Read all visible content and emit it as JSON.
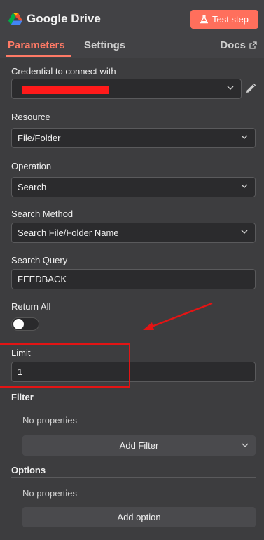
{
  "header": {
    "title": "Google Drive",
    "test_button": "Test step",
    "colors": {
      "accent": "#ff6f5c",
      "background": "#3d3d3f"
    }
  },
  "tabs": [
    {
      "label": "Parameters",
      "active": true
    },
    {
      "label": "Settings",
      "active": false
    }
  ],
  "docs_label": "Docs",
  "fields": {
    "credential": {
      "label": "Credential to connect with",
      "value": ""
    },
    "resource": {
      "label": "Resource",
      "value": "File/Folder"
    },
    "operation": {
      "label": "Operation",
      "value": "Search"
    },
    "search_method": {
      "label": "Search Method",
      "value": "Search File/Folder Name"
    },
    "search_query": {
      "label": "Search Query",
      "value": "FEEDBACK"
    },
    "return_all": {
      "label": "Return All",
      "enabled": false
    },
    "limit": {
      "label": "Limit",
      "value": "1"
    }
  },
  "filter": {
    "label": "Filter",
    "empty_text": "No properties",
    "add_button": "Add Filter"
  },
  "options": {
    "label": "Options",
    "empty_text": "No properties",
    "add_button": "Add option"
  },
  "icons": [
    "google-drive-icon",
    "flask-icon",
    "external-link-icon",
    "chevron-down-icon",
    "pencil-icon"
  ]
}
